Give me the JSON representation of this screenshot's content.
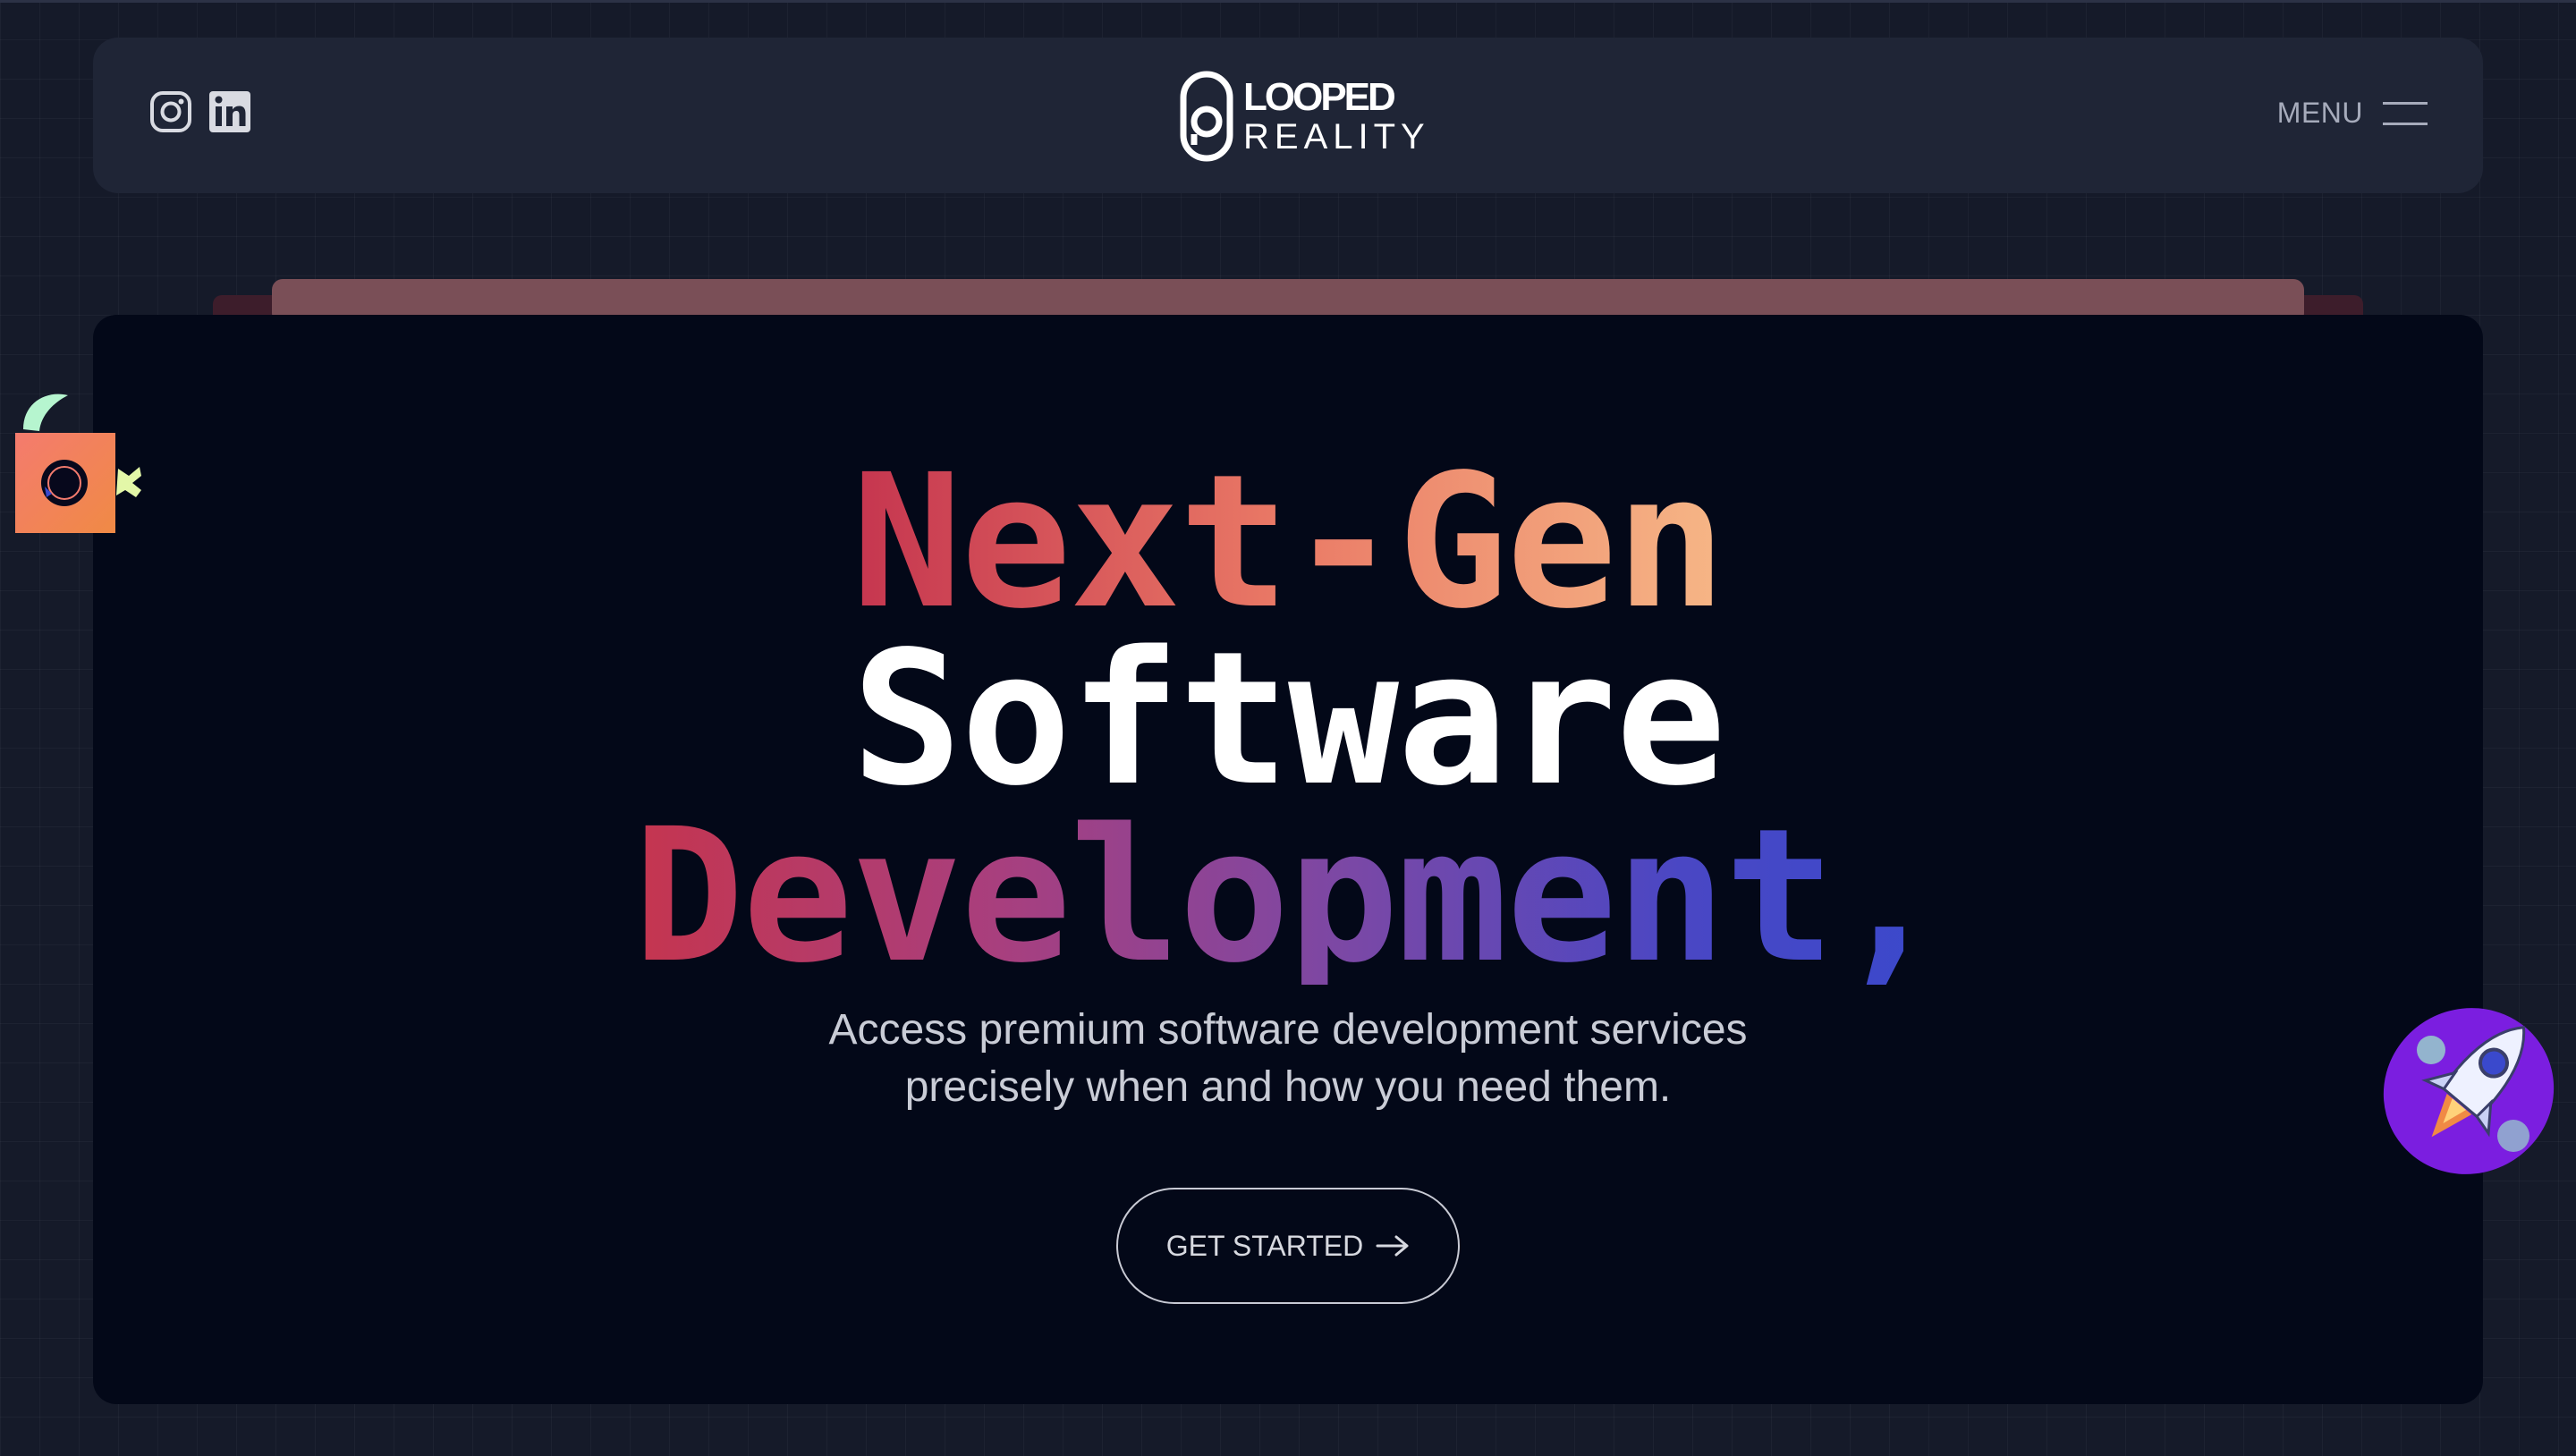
{
  "header": {
    "brand": {
      "line1": "LOOPED",
      "line2": "REALITY"
    },
    "social": [
      {
        "name": "instagram",
        "icon": "instagram-icon"
      },
      {
        "name": "linkedin",
        "icon": "linkedin-icon"
      }
    ],
    "menu_label": "MENU"
  },
  "hero": {
    "headline": [
      "Next-Gen",
      "Software",
      "Development,"
    ],
    "subtitle": [
      "Access premium software development services",
      "precisely when and how you need them."
    ],
    "cta_label": "GET STARTED"
  },
  "colors": {
    "background": "#151a29",
    "navbar": "#1f2536",
    "card": "#030818",
    "gradient_warm": [
      "#c5354f",
      "#ea7a66",
      "#f6b686"
    ],
    "gradient_cool": [
      "#c5354f",
      "#7a48a6",
      "#3a49cc"
    ]
  }
}
